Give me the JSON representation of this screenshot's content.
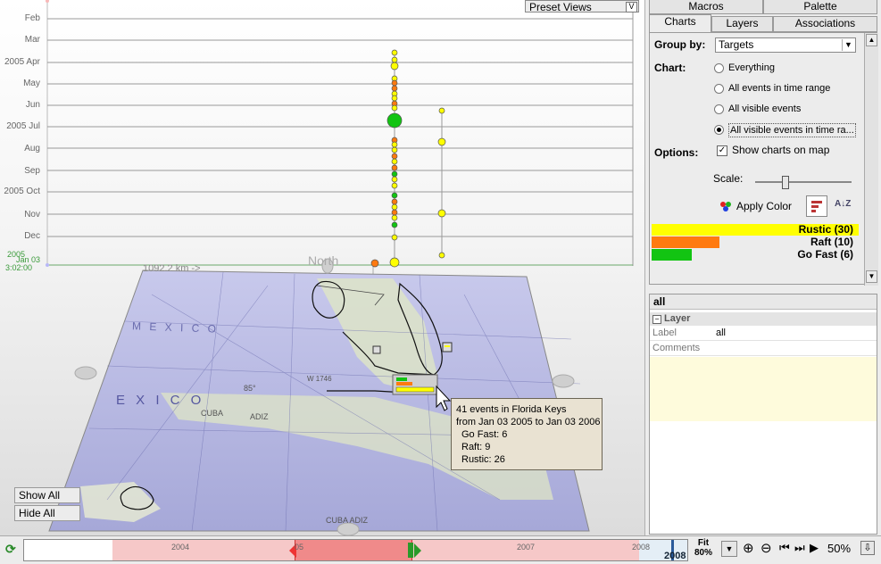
{
  "months": [
    "Feb",
    "Mar",
    "2005 Apr",
    "May",
    "Jun",
    "2005 Jul",
    "Aug",
    "Sep",
    "2005 Oct",
    "Nov",
    "Dec"
  ],
  "first_month_label_a": "2005",
  "first_month_label_b": "Jan 03",
  "first_month_label_c": "3:02:00",
  "preset_views": "Preset Views",
  "preset_dd": "V",
  "scale_text": "1092.2 km ->",
  "compass": "North",
  "map_labels": {
    "mexico_top": "M E X I C O",
    "mexico": "E X I C O",
    "cuba": "CUBA",
    "adiz": "ADIZ",
    "cuba_adiz": "CUBA ADIZ",
    "lat": "85°",
    "w1746": "W 1746"
  },
  "show_all": "Show All",
  "hide_all": "Hide All",
  "tooltip": {
    "line1": "41 events in Florida Keys",
    "line2": "from Jan 03 2005 to Jan 03 2006",
    "go_fast": "Go Fast: 6",
    "raft": "Raft: 9",
    "rustic": "Rustic: 26"
  },
  "tabs_top": [
    "Macros",
    "Palette"
  ],
  "tabs": [
    "Charts",
    "Layers",
    "Associations"
  ],
  "charts_panel": {
    "group_by_label": "Group by:",
    "group_by_value": "Targets",
    "chart_label": "Chart:",
    "radios": [
      "Everything",
      "All events in time range",
      "All visible events",
      "All visible events in time ra..."
    ],
    "options_label": "Options:",
    "show_charts": "Show charts on map",
    "scale_label": "Scale:",
    "scale_value": 0.3,
    "apply_color": "Apply Color",
    "legend": [
      {
        "label": "Rustic (30)",
        "value": 30,
        "color": "#ffff00"
      },
      {
        "label": "Raft (10)",
        "value": 10,
        "color": "#ff7a10"
      },
      {
        "label": "Go Fast (6)",
        "value": 6,
        "color": "#12c412"
      }
    ]
  },
  "properties": {
    "header": "all",
    "section": "Layer",
    "rows": [
      {
        "key": "Label",
        "value": "all"
      },
      {
        "key": "Comments",
        "value": ""
      }
    ]
  },
  "timeline": {
    "years": [
      "2004",
      "05",
      "2007",
      "2008"
    ],
    "current_year": "2008",
    "fit_label": "Fit",
    "fit_value": "80%",
    "zoom": "50%"
  },
  "colors": {
    "rustic": "#ffff00",
    "raft": "#ff7a10",
    "gofast": "#12c412",
    "range": "#f6c8c8"
  }
}
